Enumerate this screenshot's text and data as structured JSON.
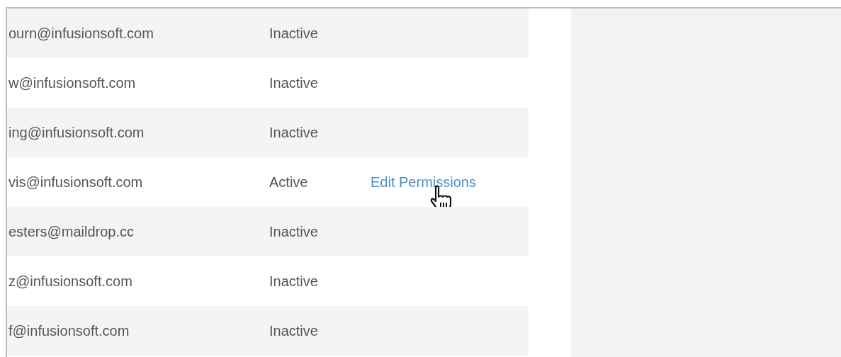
{
  "users": [
    {
      "email": "ourn@infusionsoft.com",
      "status": "Inactive"
    },
    {
      "email": "w@infusionsoft.com",
      "status": "Inactive"
    },
    {
      "email": "ing@infusionsoft.com",
      "status": "Inactive"
    },
    {
      "email": "vis@infusionsoft.com",
      "status": "Active",
      "action": "Edit Permissions",
      "hovered": true
    },
    {
      "email": "esters@maildrop.cc",
      "status": "Inactive"
    },
    {
      "email": "z@infusionsoft.com",
      "status": "Inactive"
    },
    {
      "email": "f@infusionsoft.com",
      "status": "Inactive"
    }
  ]
}
